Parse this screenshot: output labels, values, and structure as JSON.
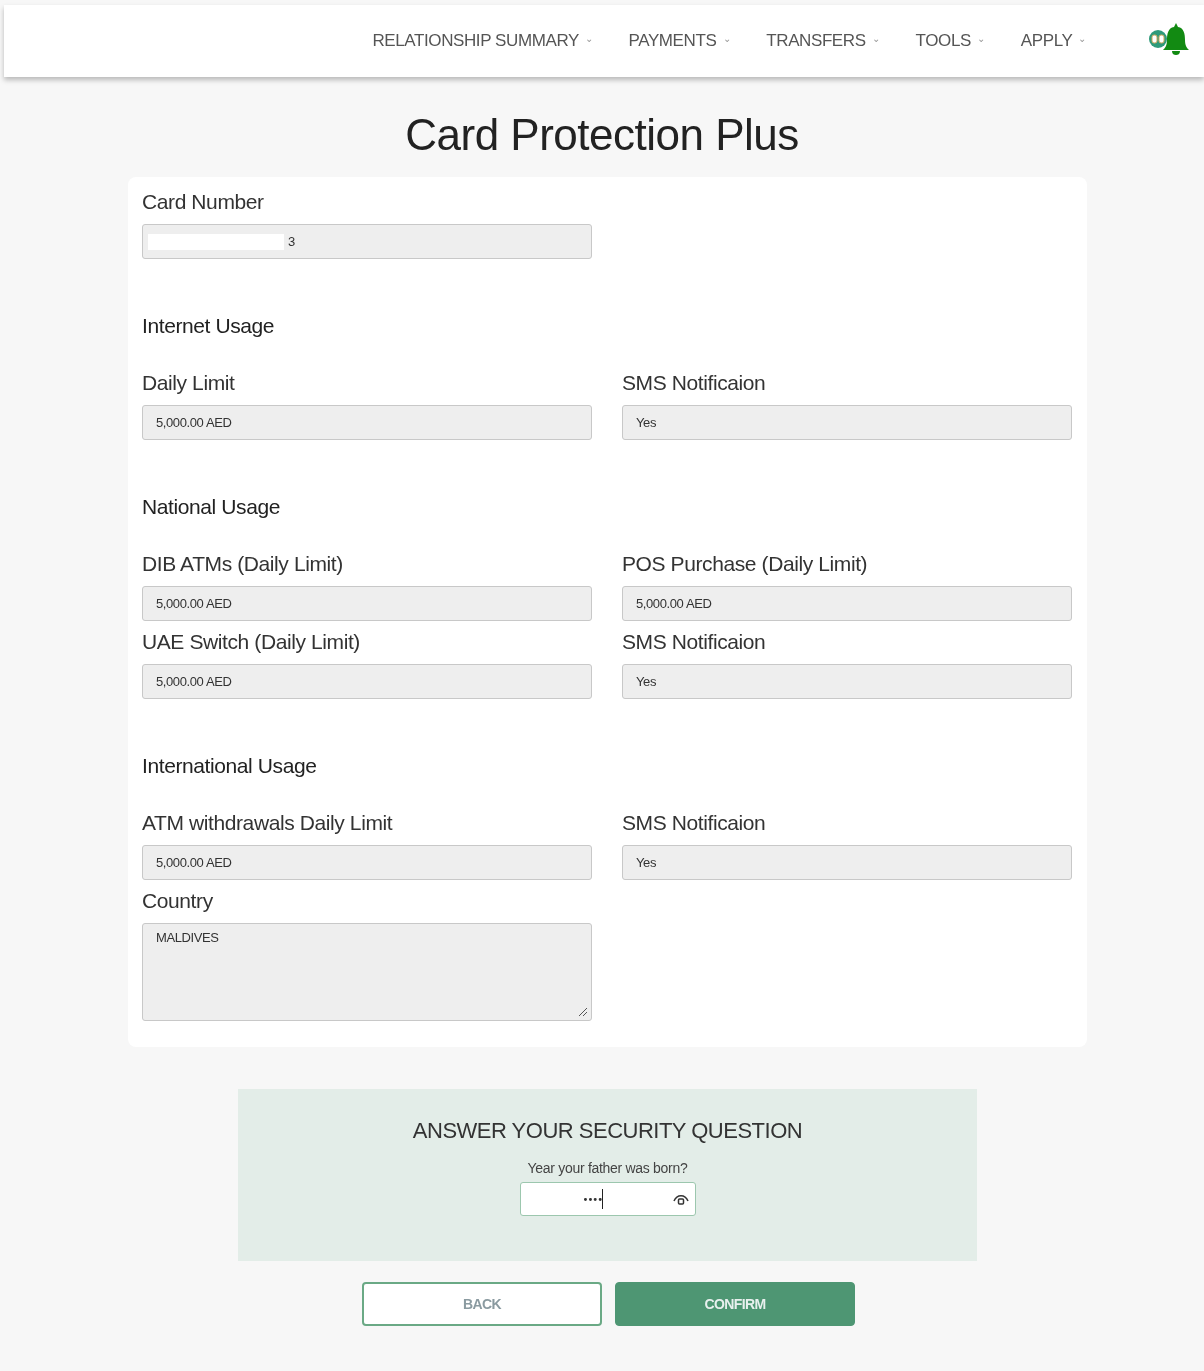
{
  "nav": {
    "items": [
      {
        "label": "RELATIONSHIP SUMMARY",
        "caret": "⌄"
      },
      {
        "label": "PAYMENTS",
        "caret": "⌄"
      },
      {
        "label": "TRANSFERS",
        "caret": "⌄"
      },
      {
        "label": "TOOLS",
        "caret": "⌄"
      },
      {
        "label": "APPLY",
        "caret": "⌄"
      }
    ]
  },
  "title": "Card Protection Plus",
  "card_number": {
    "label": "Card Number",
    "value": "3"
  },
  "sections": [
    {
      "heading": "Internet Usage",
      "fields": [
        {
          "kind": "input",
          "label": "Daily Limit",
          "value": "5,000.00 AED"
        },
        {
          "kind": "input",
          "label": "SMS Notificaion",
          "value": "Yes"
        }
      ]
    },
    {
      "heading": "National Usage",
      "fields": [
        {
          "kind": "input",
          "label": "DIB ATMs (Daily Limit)",
          "value": "5,000.00 AED"
        },
        {
          "kind": "input",
          "label": "POS Purchase (Daily Limit)",
          "value": "5,000.00 AED"
        },
        {
          "kind": "input",
          "label": "UAE Switch (Daily Limit)",
          "value": "5,000.00 AED"
        },
        {
          "kind": "input",
          "label": "SMS Notificaion",
          "value": "Yes"
        }
      ]
    },
    {
      "heading": "International Usage",
      "fields": [
        {
          "kind": "input",
          "label": "ATM withdrawals Daily Limit",
          "value": "5,000.00 AED"
        },
        {
          "kind": "input",
          "label": "SMS Notificaion",
          "value": "Yes"
        },
        {
          "kind": "textarea",
          "label": "Country",
          "value": "MALDIVES"
        }
      ]
    }
  ],
  "security": {
    "heading": "ANSWER YOUR SECURITY QUESTION",
    "question": "Year your father was born?",
    "answer": "••••"
  },
  "buttons": [
    {
      "kind": "secondary",
      "label": "BACK"
    },
    {
      "kind": "primary",
      "label": "CONFIRM"
    }
  ]
}
